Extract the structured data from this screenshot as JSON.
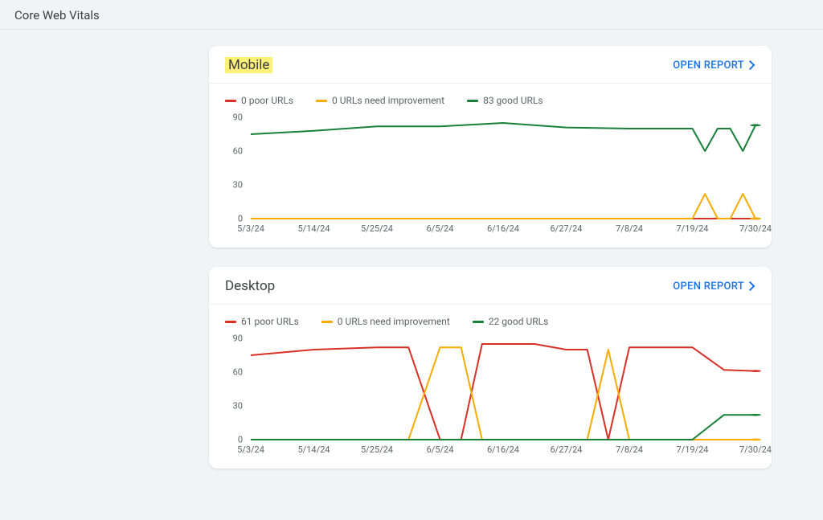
{
  "page_title": "Core Web Vitals",
  "open_report_label": "OPEN REPORT",
  "colors": {
    "poor": "#d93025",
    "needs": "#f9ab00",
    "good": "#188038",
    "axis": "#dadce0"
  },
  "x_ticks": [
    "5/3/24",
    "5/14/24",
    "5/25/24",
    "6/5/24",
    "6/16/24",
    "6/27/24",
    "7/8/24",
    "7/19/24",
    "7/30/24"
  ],
  "y_ticks": [
    0,
    30,
    60,
    90
  ],
  "cards": [
    {
      "id": "mobile",
      "title": "Mobile",
      "highlighted": true,
      "legend": [
        {
          "color_key": "poor",
          "label": "0 poor URLs"
        },
        {
          "color_key": "needs",
          "label": "0 URLs need improvement"
        },
        {
          "color_key": "good",
          "label": "83 good URLs"
        }
      ]
    },
    {
      "id": "desktop",
      "title": "Desktop",
      "highlighted": false,
      "legend": [
        {
          "color_key": "poor",
          "label": "61 poor URLs"
        },
        {
          "color_key": "needs",
          "label": "0 URLs need improvement"
        },
        {
          "color_key": "good",
          "label": "22 good URLs"
        }
      ]
    }
  ],
  "chart_data": [
    {
      "type": "line",
      "title": "Mobile",
      "xlabel": "",
      "ylabel": "",
      "ylim": [
        0,
        90
      ],
      "x": [
        "5/3/24",
        "5/14/24",
        "5/25/24",
        "6/5/24",
        "6/16/24",
        "6/27/24",
        "7/8/24",
        "7/19/24",
        "7/22/24",
        "7/24/24",
        "7/27/24",
        "7/28/24",
        "7/30/24"
      ],
      "series": [
        {
          "name": "poor",
          "color_key": "poor",
          "values": [
            0,
            0,
            0,
            0,
            0,
            0,
            0,
            0,
            0,
            0,
            0,
            0,
            0
          ]
        },
        {
          "name": "needs_improvement",
          "color_key": "needs",
          "values": [
            0,
            0,
            0,
            0,
            0,
            0,
            0,
            0,
            22,
            0,
            0,
            22,
            0
          ]
        },
        {
          "name": "good",
          "color_key": "good",
          "values": [
            75,
            78,
            82,
            82,
            85,
            81,
            80,
            80,
            60,
            80,
            80,
            60,
            83
          ]
        }
      ]
    },
    {
      "type": "line",
      "title": "Desktop",
      "xlabel": "",
      "ylabel": "",
      "ylim": [
        0,
        90
      ],
      "x": [
        "5/3/24",
        "5/14/24",
        "5/25/24",
        "6/3/24",
        "6/5/24",
        "6/11/24",
        "6/12/24",
        "6/16/24",
        "6/23/24",
        "6/27/24",
        "7/1/24",
        "7/2/24",
        "7/8/24",
        "7/19/24",
        "7/21/24",
        "7/30/24"
      ],
      "series": [
        {
          "name": "poor",
          "color_key": "poor",
          "values": [
            75,
            80,
            82,
            82,
            0,
            0,
            85,
            85,
            85,
            80,
            80,
            0,
            82,
            82,
            62,
            61
          ]
        },
        {
          "name": "needs_improvement",
          "color_key": "needs",
          "values": [
            0,
            0,
            0,
            0,
            82,
            82,
            0,
            0,
            0,
            0,
            0,
            80,
            0,
            0,
            0,
            0
          ]
        },
        {
          "name": "good",
          "color_key": "good",
          "values": [
            0,
            0,
            0,
            0,
            0,
            0,
            0,
            0,
            0,
            0,
            0,
            0,
            0,
            0,
            22,
            22
          ]
        }
      ]
    }
  ]
}
